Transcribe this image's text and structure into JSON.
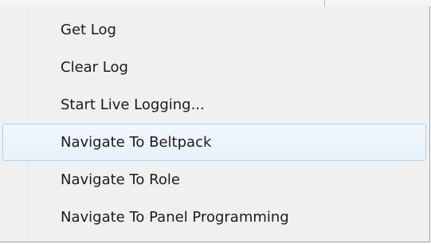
{
  "context_menu": {
    "items": [
      {
        "label": "Get Log",
        "highlighted": false
      },
      {
        "label": "Clear Log",
        "highlighted": false
      },
      {
        "label": "Start Live Logging...",
        "highlighted": false
      },
      {
        "label": "Navigate To Beltpack",
        "highlighted": true
      },
      {
        "label": "Navigate To Role",
        "highlighted": false
      },
      {
        "label": "Navigate To Panel Programming",
        "highlighted": false
      }
    ]
  },
  "colors": {
    "menu_background": "#f0f0f0",
    "highlight_fill": "#e6f1fb",
    "highlight_border": "#a8d2f0",
    "text": "#1b1b1b"
  }
}
